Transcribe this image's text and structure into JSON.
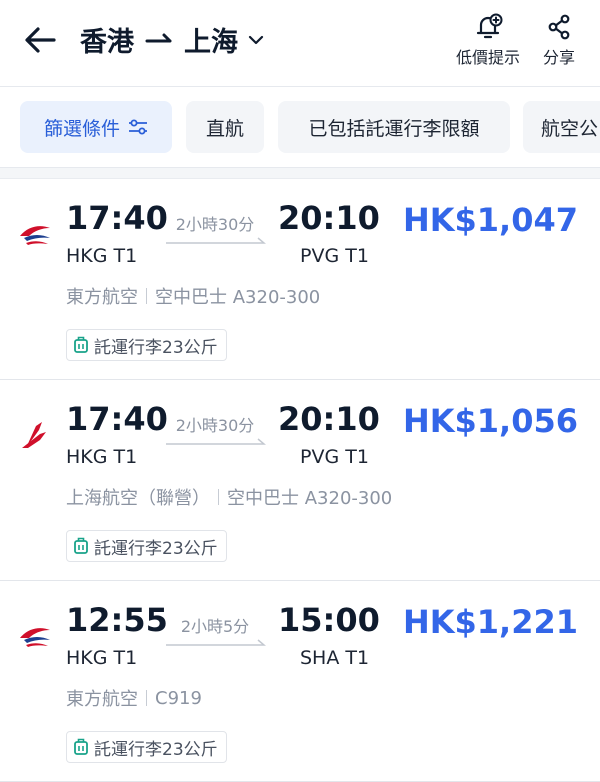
{
  "header": {
    "origin": "香港",
    "destination": "上海",
    "actions": [
      {
        "label": "低價提示",
        "icon": "bell-plus-icon"
      },
      {
        "label": "分享",
        "icon": "share-icon"
      }
    ]
  },
  "filters": [
    {
      "label": "篩選條件",
      "icon": "filter-icon",
      "active": true
    },
    {
      "label": "直航"
    },
    {
      "label": "已包括託運行李限額"
    },
    {
      "label": "航空公"
    }
  ],
  "flights": [
    {
      "airline_logo": "china-eastern-logo",
      "depart_time": "17:40",
      "depart_airport": "HKG T1",
      "duration": "2小時30分",
      "arrive_time": "20:10",
      "arrive_airport": "PVG T1",
      "price": "HK$1,047",
      "airline": "東方航空",
      "aircraft": "空中巴士 A320-300",
      "baggage": "託運行李23公斤"
    },
    {
      "airline_logo": "shanghai-airlines-logo",
      "depart_time": "17:40",
      "depart_airport": "HKG T1",
      "duration": "2小時30分",
      "arrive_time": "20:10",
      "arrive_airport": "PVG T1",
      "price": "HK$1,056",
      "airline": "上海航空（聯營）",
      "aircraft": "空中巴士 A320-300",
      "baggage": "託運行李23公斤"
    },
    {
      "airline_logo": "china-eastern-logo",
      "depart_time": "12:55",
      "depart_airport": "HKG T1",
      "duration": "2小時5分",
      "arrive_time": "15:00",
      "arrive_airport": "SHA T1",
      "price": "HK$1,221",
      "airline": "東方航空",
      "aircraft": "C919",
      "baggage": "託運行李23公斤"
    }
  ],
  "colors": {
    "price": "#3366e8",
    "accent": "#2a5fd8",
    "text": "#0f1b2d",
    "muted": "#8b93a1",
    "baggage_icon": "#19a38a"
  }
}
